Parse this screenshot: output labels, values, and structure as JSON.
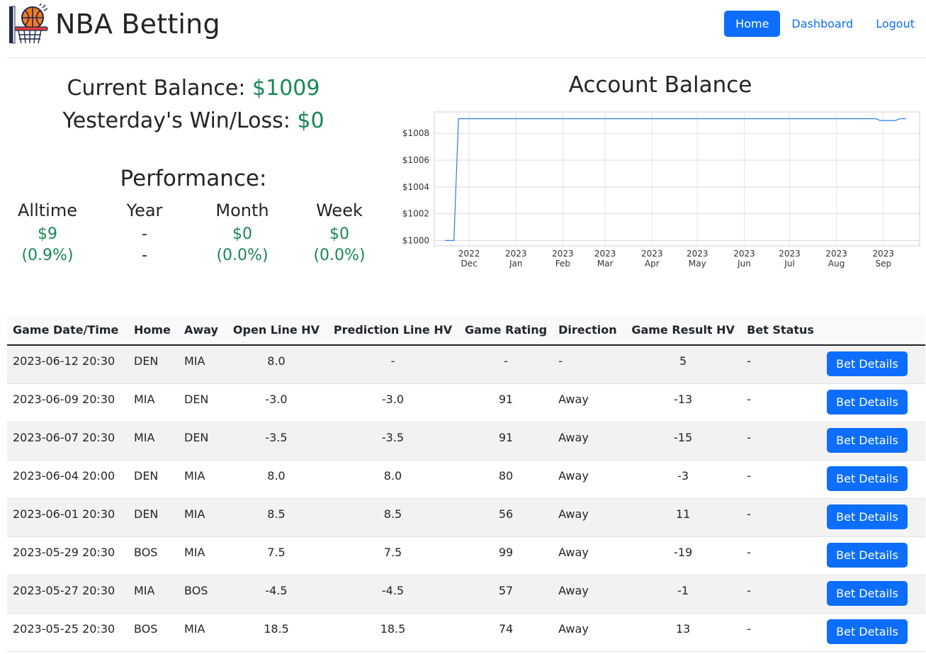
{
  "navbar": {
    "brand": "NBA Betting",
    "links": [
      {
        "label": "Home",
        "active": true
      },
      {
        "label": "Dashboard",
        "active": false
      },
      {
        "label": "Logout",
        "active": false
      }
    ]
  },
  "stats": {
    "balance_label": "Current Balance: ",
    "balance_value": "$1009",
    "yesterday_label": "Yesterday's Win/Loss: ",
    "yesterday_value": "$0"
  },
  "performance": {
    "title": "Performance:",
    "columns": [
      {
        "label": "Alltime",
        "amount": "$9",
        "pct": "(0.9%)"
      },
      {
        "label": "Year",
        "amount": "-",
        "pct": "-"
      },
      {
        "label": "Month",
        "amount": "$0",
        "pct": "(0.0%)"
      },
      {
        "label": "Week",
        "amount": "$0",
        "pct": "(0.0%)"
      }
    ]
  },
  "chart_data": {
    "type": "line",
    "title": "Account Balance",
    "xlabel": "",
    "ylabel": "",
    "ylim": [
      999.6,
      1009.6
    ],
    "xlim": [
      "2022-11-08",
      "2023-09-25"
    ],
    "yticks": [
      1000,
      1002,
      1004,
      1006,
      1008
    ],
    "ytick_labels": [
      "$1000",
      "$1002",
      "$1004",
      "$1006",
      "$1008"
    ],
    "xticks": [
      {
        "date": "2022-12-01",
        "line1": "2022",
        "line2": "Dec"
      },
      {
        "date": "2023-01-01",
        "line1": "2023",
        "line2": "Jan"
      },
      {
        "date": "2023-02-01",
        "line1": "2023",
        "line2": "Feb"
      },
      {
        "date": "2023-03-01",
        "line1": "2023",
        "line2": "Mar"
      },
      {
        "date": "2023-04-01",
        "line1": "2023",
        "line2": "Apr"
      },
      {
        "date": "2023-05-01",
        "line1": "2023",
        "line2": "May"
      },
      {
        "date": "2023-06-01",
        "line1": "2023",
        "line2": "Jun"
      },
      {
        "date": "2023-07-01",
        "line1": "2023",
        "line2": "Jul"
      },
      {
        "date": "2023-08-01",
        "line1": "2023",
        "line2": "Aug"
      },
      {
        "date": "2023-09-01",
        "line1": "2023",
        "line2": "Sep"
      }
    ],
    "grid": true,
    "series": [
      {
        "color": "#2b7bf0",
        "points": [
          [
            "2022-11-15",
            1000.0
          ],
          [
            "2022-11-21",
            1000.0
          ],
          [
            "2022-11-24",
            1009.1
          ],
          [
            "2023-08-27",
            1009.1
          ],
          [
            "2023-08-30",
            1008.96
          ],
          [
            "2023-09-09",
            1008.96
          ],
          [
            "2023-09-12",
            1009.1
          ],
          [
            "2023-09-16",
            1009.1
          ]
        ]
      }
    ]
  },
  "table": {
    "headers": [
      "Game Date/Time",
      "Home",
      "Away",
      "Open Line HV",
      "Prediction Line HV",
      "Game Rating",
      "Direction",
      "Game Result HV",
      "Bet Status",
      ""
    ],
    "button_label": "Bet Details",
    "rows": [
      [
        "2023-06-12 20:30",
        "DEN",
        "MIA",
        "8.0",
        "-",
        "-",
        "-",
        "5",
        "-"
      ],
      [
        "2023-06-09 20:30",
        "MIA",
        "DEN",
        "-3.0",
        "-3.0",
        "91",
        "Away",
        "-13",
        "-"
      ],
      [
        "2023-06-07 20:30",
        "MIA",
        "DEN",
        "-3.5",
        "-3.5",
        "91",
        "Away",
        "-15",
        "-"
      ],
      [
        "2023-06-04 20:00",
        "DEN",
        "MIA",
        "8.0",
        "8.0",
        "80",
        "Away",
        "-3",
        "-"
      ],
      [
        "2023-06-01 20:30",
        "DEN",
        "MIA",
        "8.5",
        "8.5",
        "56",
        "Away",
        "11",
        "-"
      ],
      [
        "2023-05-29 20:30",
        "BOS",
        "MIA",
        "7.5",
        "7.5",
        "99",
        "Away",
        "-19",
        "-"
      ],
      [
        "2023-05-27 20:30",
        "MIA",
        "BOS",
        "-4.5",
        "-4.5",
        "57",
        "Away",
        "-1",
        "-"
      ],
      [
        "2023-05-25 20:30",
        "BOS",
        "MIA",
        "18.5",
        "18.5",
        "74",
        "Away",
        "13",
        "-"
      ]
    ]
  },
  "colors": {
    "primary": "#0d6efd",
    "success": "#198754"
  }
}
